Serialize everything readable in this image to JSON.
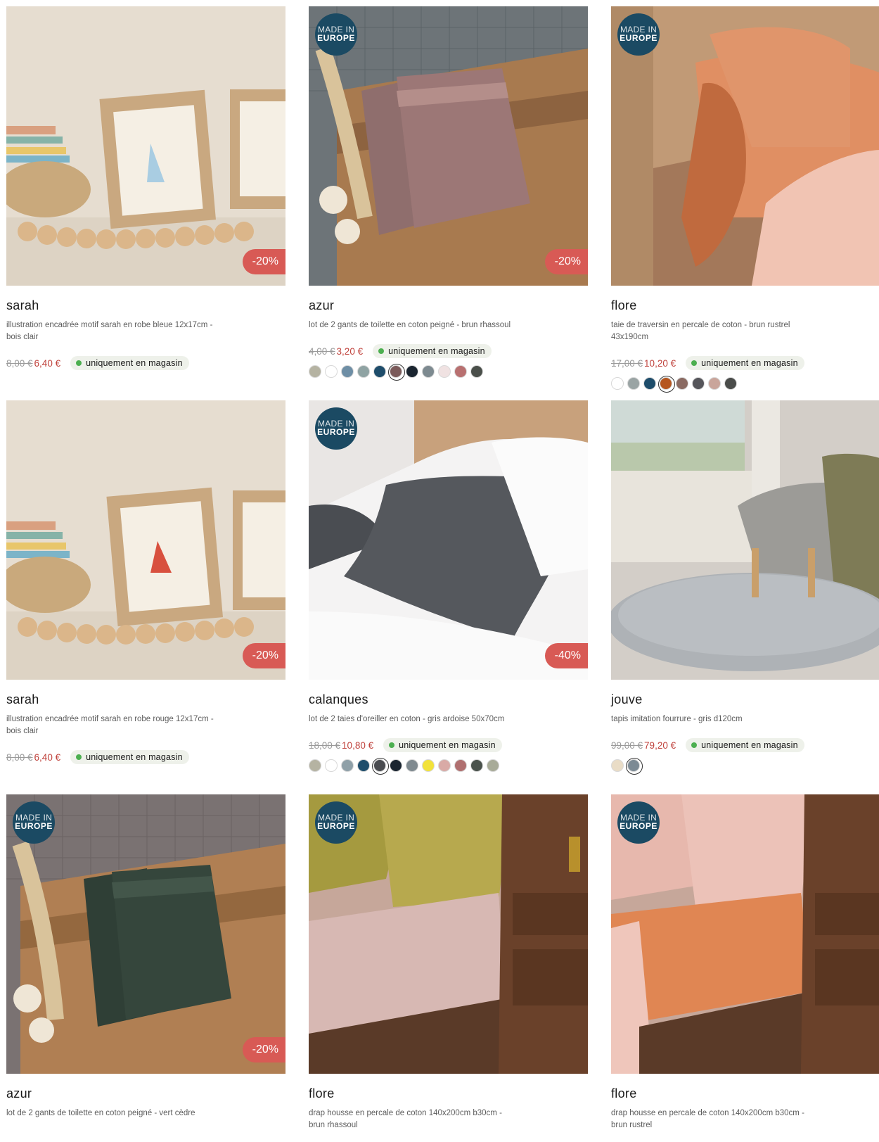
{
  "badge": {
    "made_in_line1": "MADE IN",
    "made_in_line2": "EUROPE"
  },
  "availability_label": "uniquement en magasin",
  "products": [
    {
      "name": "sarah",
      "description": "illustration encadrée motif sarah en robe bleue 12x17cm - bois clair",
      "old_price": "8,00 €",
      "price": "6,40 €",
      "discount": "-20%",
      "made_in_europe": false,
      "swatches": []
    },
    {
      "name": "azur",
      "description": "lot de 2 gants de toilette en coton peigné - brun rhassoul",
      "old_price": "4,00 €",
      "price": "3,20 €",
      "discount": "-20%",
      "made_in_europe": true,
      "swatches": [
        "#b5b3a2",
        "#ffffff",
        "#6e8ea5",
        "#8fa3a3",
        "#1e4d6b",
        "#7a5a5a",
        "#1a2530",
        "#7d8a90",
        "#f0e2e2",
        "#b87070",
        "#4a4f4a"
      ],
      "selected_swatch": 5
    },
    {
      "name": "flore",
      "description": "taie de traversin en percale de coton - brun rustrel 43x190cm",
      "old_price": "17,00 €",
      "price": "10,20 €",
      "discount": "",
      "made_in_europe": true,
      "swatches": [
        "#ffffff",
        "#9aa4a4",
        "#1e4d6b",
        "#b5561f",
        "#8a6a62",
        "#55555a",
        "#c9a59b",
        "#4a4c4a"
      ],
      "selected_swatch": 3
    },
    {
      "name": "sarah",
      "description": "illustration encadrée motif sarah en robe rouge 12x17cm - bois clair",
      "old_price": "8,00 €",
      "price": "6,40 €",
      "discount": "-20%",
      "made_in_europe": false,
      "swatches": []
    },
    {
      "name": "calanques",
      "description": "lot de 2 taies d'oreiller en coton - gris ardoise 50x70cm",
      "old_price": "18,00 €",
      "price": "10,80 €",
      "discount": "-40%",
      "made_in_europe": true,
      "swatches": [
        "#b5b3a2",
        "#ffffff",
        "#8fa0a8",
        "#1e4d6b",
        "#4a4c50",
        "#1a2530",
        "#7f8a90",
        "#f2e23a",
        "#d9aaa6",
        "#b07070",
        "#4a524c",
        "#a8ab98"
      ],
      "selected_swatch": 4
    },
    {
      "name": "jouve",
      "description": "tapis imitation fourrure - gris d120cm",
      "old_price": "99,00 €",
      "price": "79,20 €",
      "discount": "",
      "made_in_europe": false,
      "swatches": [
        "#e9dcc6",
        "#7c8a94"
      ],
      "selected_swatch": 1
    },
    {
      "name": "azur",
      "description": "lot de 2 gants de toilette en coton peigné - vert cèdre",
      "old_price": "",
      "price": "",
      "discount": "-20%",
      "made_in_europe": true,
      "swatches": []
    },
    {
      "name": "flore",
      "description": "drap housse en percale de coton 140x200cm b30cm - brun rhassoul",
      "old_price": "",
      "price": "",
      "discount": "",
      "made_in_europe": true,
      "swatches": []
    },
    {
      "name": "flore",
      "description": "drap housse en percale de coton 140x200cm b30cm - brun rustrel",
      "old_price": "",
      "price": "",
      "discount": "",
      "made_in_europe": true,
      "swatches": []
    }
  ]
}
